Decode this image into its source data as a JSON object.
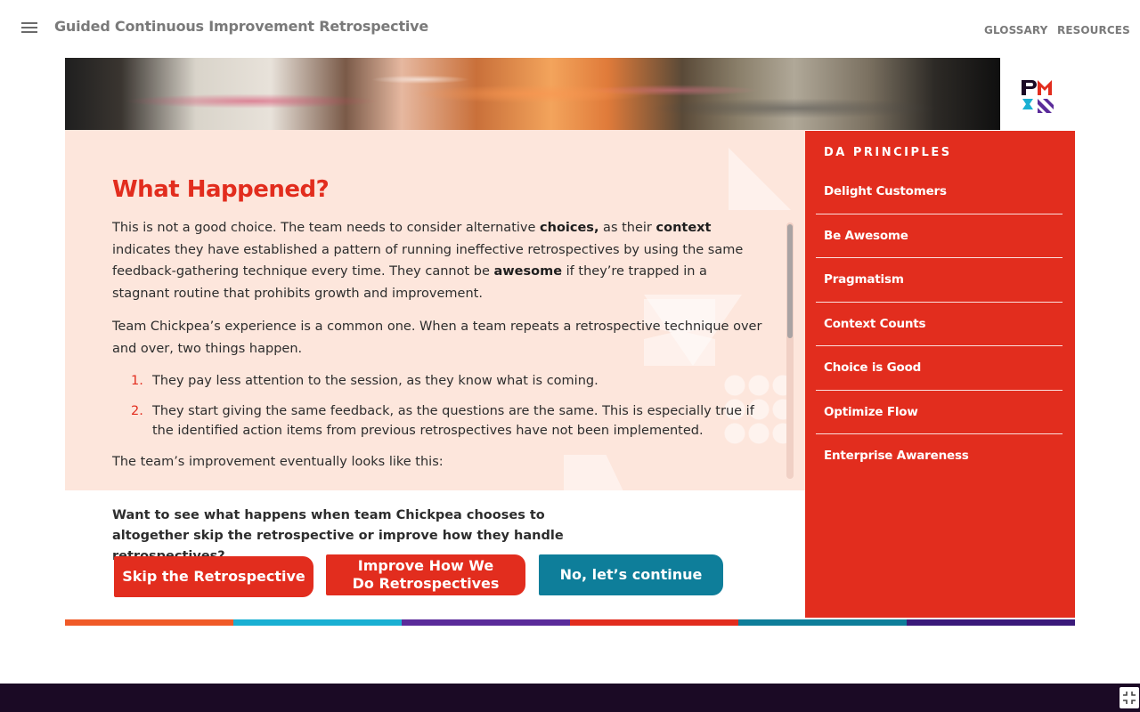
{
  "header": {
    "course_title": "Guided Continuous Improvement Retrospective",
    "nav": {
      "glossary": "GLOSSARY",
      "resources": "RESOURCES"
    }
  },
  "icons": {
    "menu": "hamburger-menu-icon",
    "logo": "pmi-logo",
    "fullscreen": "exit-fullscreen-icon"
  },
  "content": {
    "heading": "What Happened?",
    "p1": {
      "t1": "This is not a good choice. The team needs to consider alternative ",
      "b1": "choices,",
      "t2": " as their ",
      "b2": "context",
      "t3": " indicates they have established a pattern of running ineffective retrospectives by using the same feedback-gathering technique every time. They cannot be ",
      "b3": "awesome",
      "t4": " if they’re trapped in a stagnant routine that prohibits growth and improvement."
    },
    "p2": "Team Chickpea’s experience is a common one. When a team repeats a retrospective technique over and over, two things happen.",
    "list": [
      {
        "num": "1.",
        "text": "They pay less attention to the session, as they know what is coming."
      },
      {
        "num": "2.",
        "text": "They start giving the same feedback, as the questions are the same. This is especially true if the identified action items from previous retrospectives have not been implemented."
      }
    ],
    "p3": "The team’s improvement eventually looks like this:"
  },
  "question": "Want to see what happens when team Chickpea chooses to altogether skip the retrospective or improve how they handle retrospectives?",
  "buttons": {
    "skip": "Skip the Retrospective",
    "improve_line1": "Improve How We",
    "improve_line2": "Do Retrospectives",
    "continue": "No, let’s continue"
  },
  "sidebar": {
    "title": "DA PRINCIPLES",
    "items": [
      "Delight Customers",
      "Be Awesome",
      "Pragmatism",
      "Context Counts",
      "Choice is Good",
      "Optimize Flow",
      "Enterprise Awareness"
    ]
  },
  "colors": {
    "accent_red": "#e22d1e",
    "teal_button": "#0e7e9a",
    "panel_bg": "#fde6dc",
    "footer_bg": "#1b0a25",
    "strip": [
      "#f05a28",
      "#1ab0d3",
      "#5a2b9a",
      "#e22d1e",
      "#0e7e9a",
      "#3a1a7a"
    ]
  }
}
